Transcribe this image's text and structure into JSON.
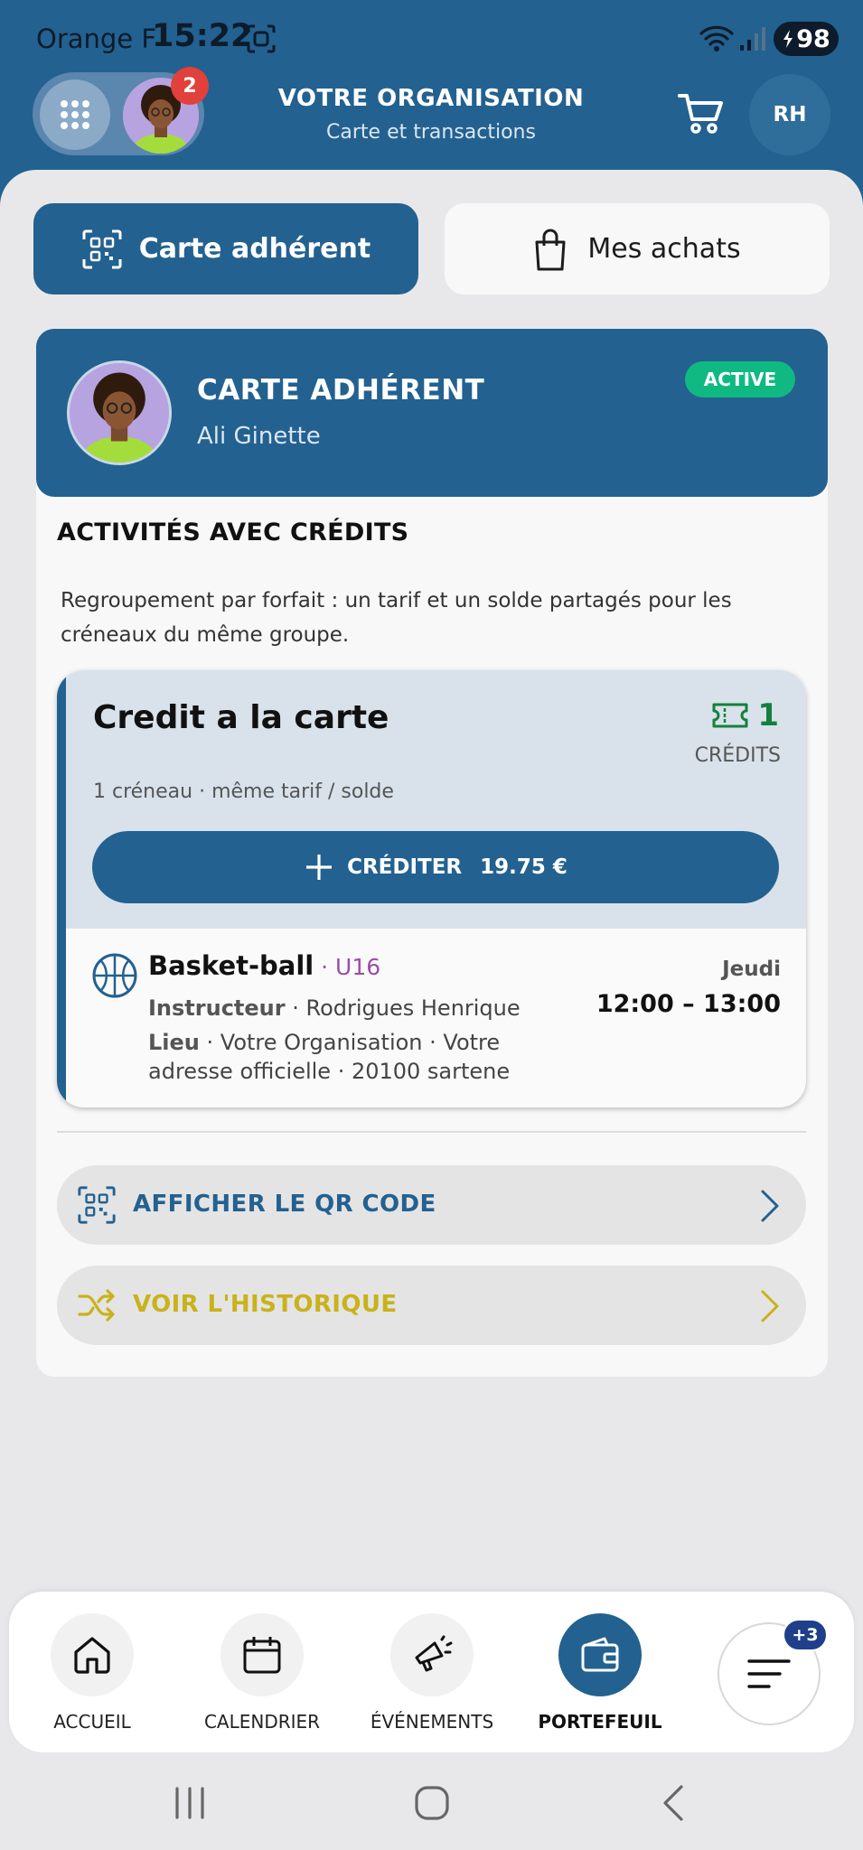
{
  "status_bar": {
    "carrier": "Orange F",
    "time": "15:22",
    "battery": "98"
  },
  "header": {
    "notification_count": "2",
    "title": "VOTRE ORGANISATION",
    "subtitle": "Carte et transactions",
    "user_initials": "RH"
  },
  "tabs": {
    "carte_label": "Carte adhérent",
    "achats_label": "Mes achats"
  },
  "member_card": {
    "title": "CARTE ADHÉRENT",
    "name": "Ali Ginette",
    "status": "ACTIVE"
  },
  "section": {
    "title": "ACTIVITÉS AVEC CRÉDITS",
    "description": "Regroupement par forfait : un tarif et un solde partagés pour les créneaux du même groupe."
  },
  "credit": {
    "name": "Credit a la carte",
    "count": "1",
    "unit": "CRÉDITS",
    "info": "1 créneau · même tarif / solde",
    "button_label": "CRÉDITER",
    "button_price": "19.75 €"
  },
  "slot": {
    "activity": "Basket-ball",
    "level": " · U16",
    "day": "Jeudi",
    "time": "12:00 – 13:00",
    "instructor_label": "Instructeur",
    "instructor": " · Rodrigues Henrique",
    "place_label": "Lieu",
    "place": " · Votre Organisation · Votre adresse officielle · 20100 sartene"
  },
  "actions": {
    "qr_label": "AFFICHER LE QR CODE",
    "history_label": "VOIR L'HISTORIQUE"
  },
  "bottom_nav": {
    "items": [
      {
        "label": "ACCUEIL"
      },
      {
        "label": "CALENDRIER"
      },
      {
        "label": "ÉVÉNEMENTS"
      },
      {
        "label": "PORTEFEUIL"
      }
    ],
    "more_badge": "+3"
  },
  "colors": {
    "primary": "#236190",
    "active_badge": "#10b981",
    "credit_green": "#15803d",
    "level_purple": "#9b4ea3",
    "history_yellow": "#c9b21a",
    "notification_red": "#e2403a"
  }
}
